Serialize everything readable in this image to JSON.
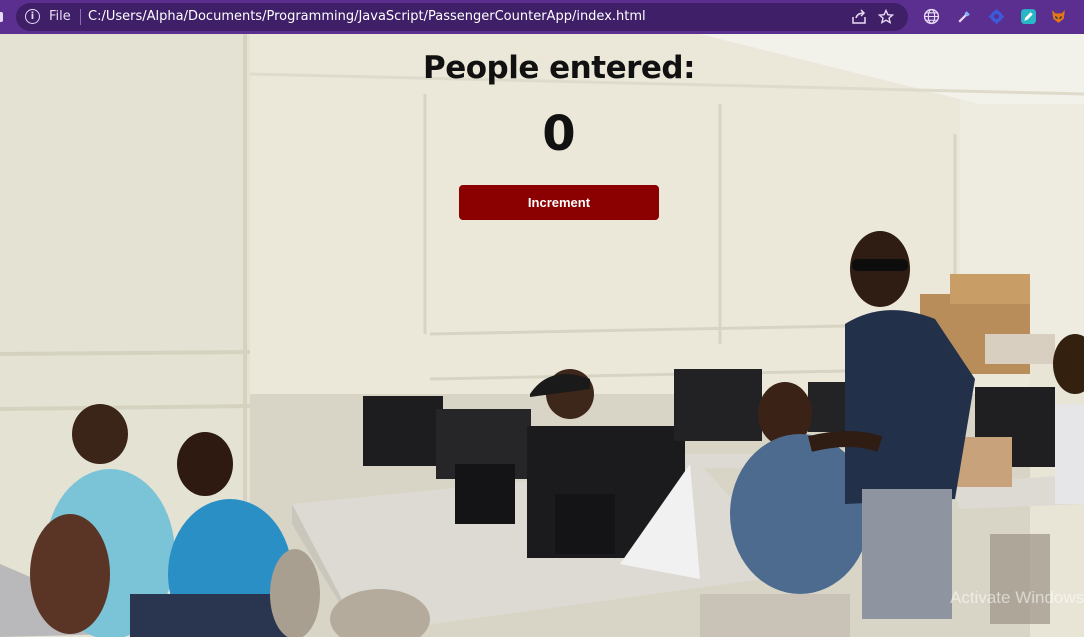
{
  "browser": {
    "scheme_label": "File",
    "url": "C:/Users/Alpha/Documents/Programming/JavaScript/PassengerCounterApp/index.html",
    "icons": [
      "info-icon",
      "share-icon",
      "star-icon",
      "globe-extension-icon",
      "color-picker-extension-icon",
      "gear-extension-icon",
      "pen-extension-icon",
      "fox-extension-icon"
    ],
    "colors": {
      "toolbar": "#5b2f8f",
      "omnibox": "#3f1f68"
    }
  },
  "app": {
    "heading": "People entered:",
    "count": "0",
    "increment_label": "Increment",
    "button_color": "#8b0000"
  },
  "overlay": {
    "watermark": "Activate Windows"
  }
}
